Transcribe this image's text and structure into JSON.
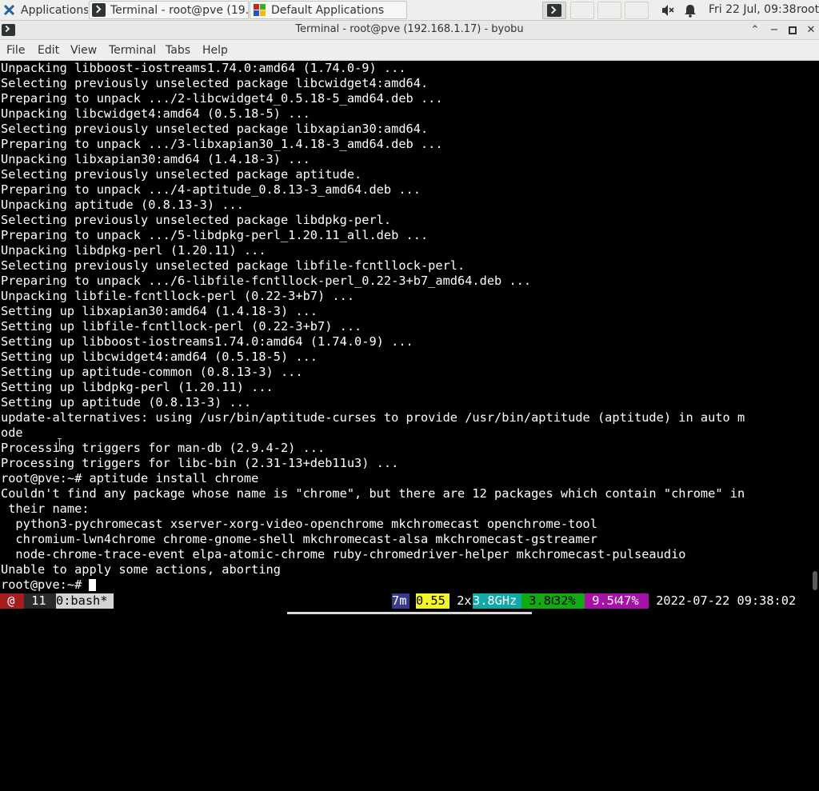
{
  "panel": {
    "apps_label": "Applications ☰",
    "tasks": [
      {
        "label": "Terminal - root@pve (19..."
      },
      {
        "label": "Default Applications"
      }
    ],
    "clock": "Fri 22 Jul, 09:38",
    "user": "root"
  },
  "window": {
    "title": "Terminal - root@pve (192.168.1.17) - byobu",
    "minimize": "⌃",
    "restore": "−",
    "maximize": "▫",
    "close": "✕"
  },
  "menubar": [
    "File",
    "Edit",
    "View",
    "Terminal",
    "Tabs",
    "Help"
  ],
  "terminal": {
    "lines": [
      "Unpacking libboost-iostreams1.74.0:amd64 (1.74.0-9) ...",
      "Selecting previously unselected package libcwidget4:amd64.",
      "Preparing to unpack .../2-libcwidget4_0.5.18-5_amd64.deb ...",
      "Unpacking libcwidget4:amd64 (0.5.18-5) ...",
      "Selecting previously unselected package libxapian30:amd64.",
      "Preparing to unpack .../3-libxapian30_1.4.18-3_amd64.deb ...",
      "Unpacking libxapian30:amd64 (1.4.18-3) ...",
      "Selecting previously unselected package aptitude.",
      "Preparing to unpack .../4-aptitude_0.8.13-3_amd64.deb ...",
      "Unpacking aptitude (0.8.13-3) ...",
      "Selecting previously unselected package libdpkg-perl.",
      "Preparing to unpack .../5-libdpkg-perl_1.20.11_all.deb ...",
      "Unpacking libdpkg-perl (1.20.11) ...",
      "Selecting previously unselected package libfile-fcntllock-perl.",
      "Preparing to unpack .../6-libfile-fcntllock-perl_0.22-3+b7_amd64.deb ...",
      "Unpacking libfile-fcntllock-perl (0.22-3+b7) ...",
      "Setting up libxapian30:amd64 (1.4.18-3) ...",
      "Setting up libfile-fcntllock-perl (0.22-3+b7) ...",
      "Setting up libboost-iostreams1.74.0:amd64 (1.74.0-9) ...",
      "Setting up libcwidget4:amd64 (0.5.18-5) ...",
      "Setting up aptitude-common (0.8.13-3) ...",
      "Setting up libdpkg-perl (1.20.11) ...",
      "Setting up aptitude (0.8.13-3) ...",
      "update-alternatives: using /usr/bin/aptitude-curses to provide /usr/bin/aptitude (aptitude) in auto m",
      "ode",
      "Processing triggers for man-db (2.9.4-2) ...",
      "Processing triggers for libc-bin (2.31-13+deb11u3) ...",
      "root@pve:~# aptitude install chrome",
      "Couldn't find any package whose name is \"chrome\", but there are 12 packages which contain \"chrome\" in",
      " their name:",
      "  python3-pychromecast xserver-xorg-video-openchrome mkchromecast openchrome-tool",
      "  chromium-lwn4chrome chrome-gnome-shell mkchromecast-alsa mkchromecast-gstreamer",
      "  node-chrome-trace-event elpa-atomic-chrome ruby-chromedriver-helper mkchromecast-pulseaudio",
      "Unable to apply some actions, aborting",
      "root@pve:~# "
    ]
  },
  "status": {
    "logo": " @ ",
    "updates": " 11 ",
    "window": "0:bash*",
    "uptime": "7m",
    "load": "0.55",
    "cpu_count": " 2x",
    "cpu_freq": "3.8GHz",
    "mem_total": " 3.8G",
    "mem_pct": "32%",
    "disk_total": " 9.5G",
    "disk_pct": "47%",
    "datetime": " 2022-07-22 09:38:02",
    "colors": {
      "logo_bg": "#a51e1e",
      "updates_bg": "#2a2a2a",
      "window_bg": "#d4d4d4",
      "uptime_bg": "#3a3a8c",
      "load_bg": "#f4f42a",
      "freq_bg": "#11a8a8",
      "mem_bg": "#11aa11",
      "disk_bg": "#a811a8"
    }
  }
}
